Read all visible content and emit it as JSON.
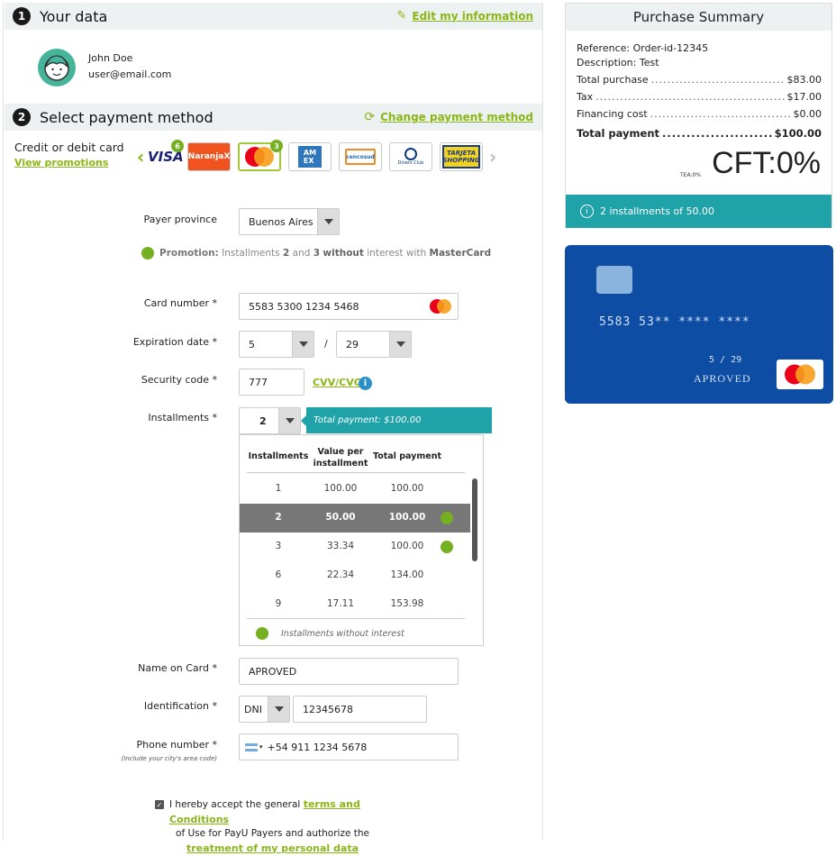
{
  "step1": {
    "number": "1",
    "title": "Your data",
    "edit_link": "Edit my information"
  },
  "user": {
    "name": "John Doe",
    "email": "user@email.com"
  },
  "step2": {
    "number": "2",
    "title": "Select payment method",
    "change_link": "Change payment method"
  },
  "payment_type": {
    "label": "Credit or debit card",
    "promotions_link": "View promotions"
  },
  "card_logos": [
    {
      "name": "VISA",
      "badge": "6"
    },
    {
      "name": "NaranjaX",
      "badge": ""
    },
    {
      "name": "Mastercard",
      "badge": "3"
    },
    {
      "name": "AMEX",
      "badge": ""
    },
    {
      "name": "cencosud",
      "badge": ""
    },
    {
      "name": "Diners Club INTERNATIONAL",
      "badge": ""
    },
    {
      "name": "TARJETA SHOPPING",
      "badge": ""
    }
  ],
  "form": {
    "province_label": "Payer province",
    "province_value": "Buenos Aires",
    "promo_prefix": "Promotion:",
    "promo_text1": "Installments",
    "promo_n1": "2",
    "promo_and": "and",
    "promo_n2": "3",
    "promo_without": "without",
    "promo_text2": "interest with",
    "promo_brand": "MasterCard",
    "card_number_label": "Card number *",
    "card_number_value": "5583 5300 1234 5468",
    "expiration_label": "Expiration date *",
    "exp_month": "5",
    "exp_sep": "/",
    "exp_year": "29",
    "security_label": "Security code *",
    "security_value": "777",
    "cvv_link": "CVV/CVC",
    "installments_label": "Installments *",
    "installments_value": "2",
    "installments_tooltip": "Total payment: $100.00",
    "name_label": "Name on Card *",
    "name_value": "APROVED",
    "id_label": "Identification *",
    "id_type": "DNI",
    "id_value": "12345678",
    "phone_label": "Phone number *",
    "phone_hint": "(Include your city's area code)",
    "phone_value": "+54 911 1234 5678",
    "terms_text1": "I hereby accept the general",
    "terms_link": "terms and Conditions",
    "terms_text2": "of Use for PayU Payers and authorize the",
    "data_link": "treatment of my personal data"
  },
  "installments_table": {
    "headers": [
      "Installments",
      "Value per installment",
      "Total payment"
    ],
    "rows": [
      {
        "n": "1",
        "value": "100.00",
        "total": "100.00",
        "promo": false
      },
      {
        "n": "2",
        "value": "50.00",
        "total": "100.00",
        "promo": true
      },
      {
        "n": "3",
        "value": "33.34",
        "total": "100.00",
        "promo": true
      },
      {
        "n": "6",
        "value": "22.34",
        "total": "134.00",
        "promo": false
      },
      {
        "n": "9",
        "value": "17.11",
        "total": "153.98",
        "promo": false
      }
    ],
    "legend": "Installments without interest"
  },
  "summary": {
    "title": "Purchase Summary",
    "reference": "Reference: Order-id-12345",
    "description": "Description: Test",
    "lines": [
      {
        "label": "Total purchase",
        "value": "$83.00"
      },
      {
        "label": "Tax",
        "value": "$17.00"
      },
      {
        "label": "Financing cost",
        "value": "$0.00"
      }
    ],
    "total_label": "Total payment",
    "total_value": "$100.00",
    "tea": "TEA:0%",
    "cft": "CFT:0%",
    "installments_info": "2 installments of 50.00"
  },
  "card_preview": {
    "number": "5583 53** **** ****",
    "expiry": "5 / 29",
    "holder": "APROVED"
  },
  "colors": {
    "accent_green": "#8ab616",
    "teal": "#1fa3a8",
    "card_blue": "#0e4da4",
    "promo_dot": "#74b020"
  }
}
